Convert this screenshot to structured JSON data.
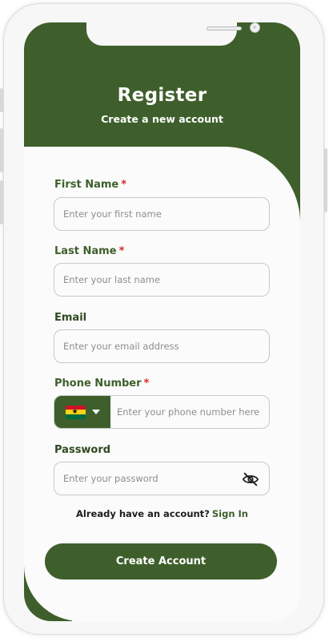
{
  "header": {
    "title": "Register",
    "subtitle": "Create a new account"
  },
  "form": {
    "first_name": {
      "label": "First Name",
      "required_mark": "*",
      "placeholder": "Enter your first name"
    },
    "last_name": {
      "label": "Last Name",
      "required_mark": "*",
      "placeholder": "Enter your last name"
    },
    "email": {
      "label": "Email",
      "placeholder": "Enter your email address"
    },
    "phone": {
      "label": "Phone Number",
      "required_mark": "*",
      "placeholder": "Enter your phone number here",
      "country_flag": "ghana-flag-icon"
    },
    "password": {
      "label": "Password",
      "placeholder": "Enter your password",
      "toggle_icon": "eye-off-icon"
    }
  },
  "footer": {
    "signin_prompt": "Already have an account?",
    "signin_link": "Sign In",
    "create_button": "Create Account"
  },
  "colors": {
    "brand_green": "#3e5f2b",
    "required_red": "#d8282d",
    "flag_red": "#ce1126",
    "flag_gold": "#fcd116",
    "flag_green": "#006b3f"
  }
}
